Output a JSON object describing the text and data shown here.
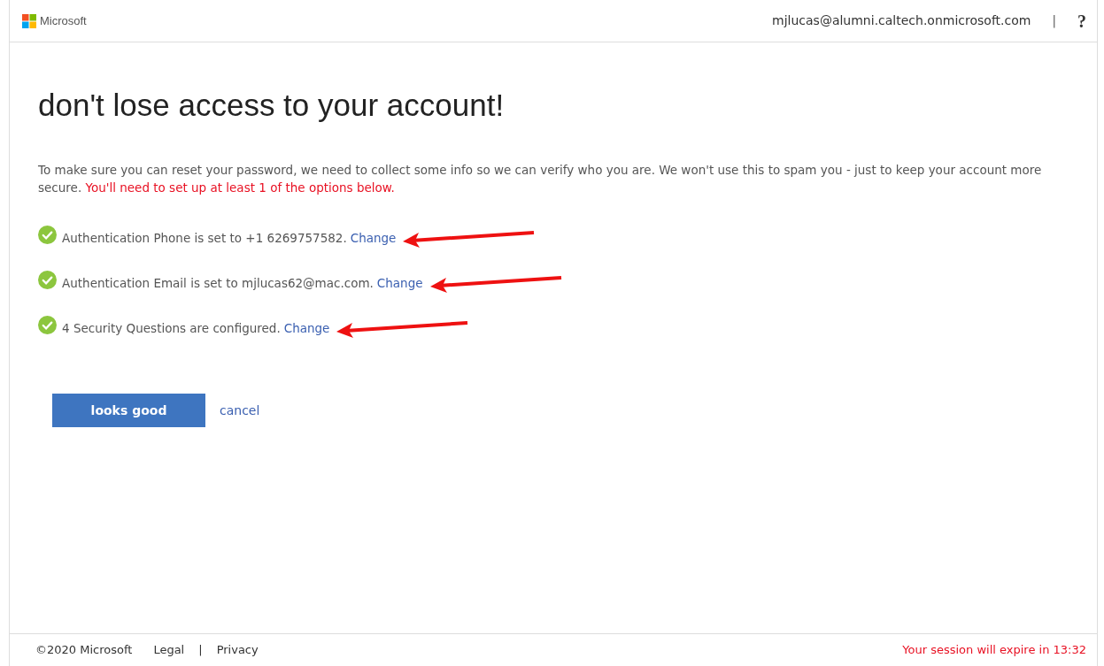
{
  "header": {
    "brand": "Microsoft",
    "account": "mjlucas@alumni.caltech.onmicrosoft.com",
    "separator": "|",
    "help": "?"
  },
  "title": "don't lose access to your account!",
  "intro": {
    "text": "To make sure you can reset your password, we need to collect some info so we can verify who you are. We won't use this to spam you - just to keep your account more secure.",
    "note": "You'll need to set up at least 1 of the options below."
  },
  "methods": [
    {
      "status": "Authentication Phone is set to +1 6269757582.",
      "link": "Change",
      "configured": true,
      "annotated": true
    },
    {
      "status": "Authentication Email is set to mjlucas62@mac.com.",
      "link": "Change",
      "configured": true,
      "annotated": true
    },
    {
      "status": "4 Security Questions are configured.",
      "link": "Change",
      "configured": true,
      "annotated": true
    }
  ],
  "buttons": {
    "primary": "looks good",
    "secondary": "cancel"
  },
  "footer": {
    "copyright": "©2020 Microsoft",
    "links": [
      "Legal",
      "Privacy"
    ],
    "separator": "|",
    "session": "Your session will expire in 13:32"
  }
}
